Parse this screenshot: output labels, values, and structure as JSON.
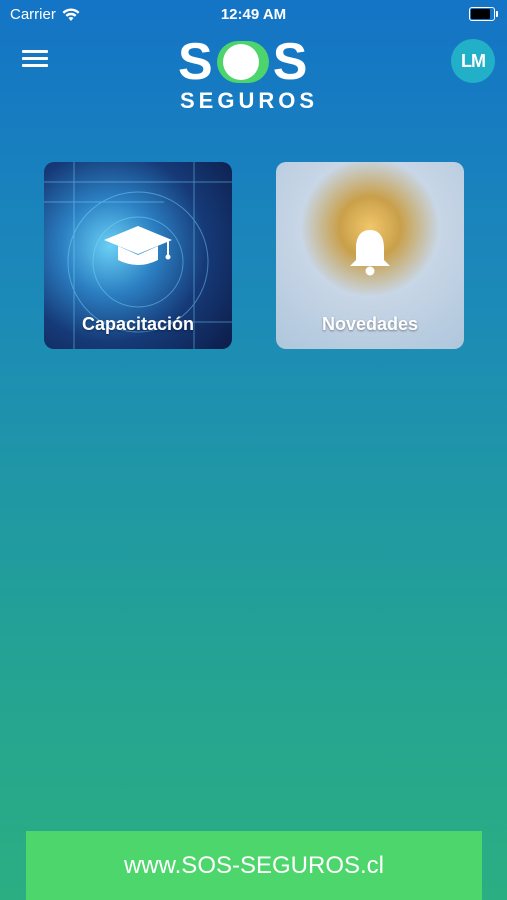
{
  "status_bar": {
    "carrier": "Carrier",
    "time": "12:49 AM"
  },
  "header": {
    "logo_left": "S",
    "logo_right": "S",
    "logo_sub": "SEGUROS",
    "avatar_text": "LM"
  },
  "cards": [
    {
      "label": "Capacitación",
      "icon": "graduation-cap-icon"
    },
    {
      "label": "Novedades",
      "icon": "bell-icon"
    }
  ],
  "footer": {
    "website": "www.SOS-SEGUROS.cl"
  },
  "colors": {
    "accent_green": "#4cd66b",
    "bg_top": "#1474c6",
    "bg_bottom": "#2bae82"
  }
}
